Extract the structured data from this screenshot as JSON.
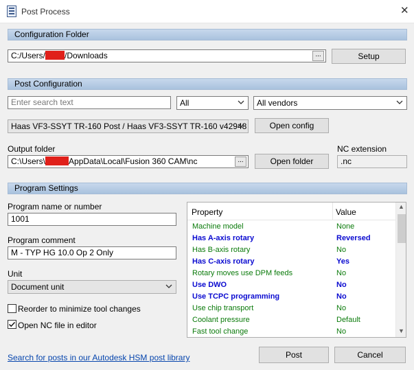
{
  "window": {
    "title": "Post Process",
    "close_glyph": "✕"
  },
  "config_folder": {
    "section_title": "Configuration Folder",
    "path_prefix": "C:/Users/",
    "path_suffix": "/Downloads",
    "browse_label": "...",
    "setup_label": "Setup"
  },
  "post_config": {
    "section_title": "Post Configuration",
    "search_placeholder": "Enter search text",
    "filter_all": "All",
    "vendor_filter": "All vendors",
    "post_selected": "Haas VF3-SSYT TR-160 Post / Haas VF3-SSYT TR-160 v42948",
    "open_config_label": "Open config",
    "output_folder_label": "Output folder",
    "output_prefix": "C:\\Users\\",
    "output_suffix": "AppData\\Local\\Fusion 360 CAM\\nc",
    "browse_label": "...",
    "open_folder_label": "Open folder",
    "nc_extension_label": "NC extension",
    "nc_extension_value": ".nc"
  },
  "program_settings": {
    "section_title": "Program Settings",
    "program_name_label": "Program name or number",
    "program_name_value": "1001",
    "program_comment_label": "Program comment",
    "program_comment_value": "M - TYP HG 10.0 Op 2 Only",
    "unit_label": "Unit",
    "unit_value": "Document unit",
    "reorder_label": "Reorder to minimize tool changes",
    "reorder_checked": false,
    "open_nc_label": "Open NC file in editor",
    "open_nc_checked": true
  },
  "properties": {
    "header_property": "Property",
    "header_value": "Value",
    "rows": [
      {
        "property": "Machine model",
        "value": "None",
        "style": "green"
      },
      {
        "property": "Has A-axis rotary",
        "value": "Reversed",
        "style": "blue"
      },
      {
        "property": "Has B-axis rotary",
        "value": "No",
        "style": "green"
      },
      {
        "property": "Has C-axis rotary",
        "value": "Yes",
        "style": "blue"
      },
      {
        "property": "Rotary moves use DPM feeds",
        "value": "No",
        "style": "green"
      },
      {
        "property": "Use DWO",
        "value": "No",
        "style": "blue"
      },
      {
        "property": "Use TCPC programming",
        "value": "No",
        "style": "blue"
      },
      {
        "property": "Use chip transport",
        "value": "No",
        "style": "green"
      },
      {
        "property": "Coolant pressure",
        "value": "Default",
        "style": "green"
      },
      {
        "property": "Fast tool change",
        "value": "No",
        "style": "green"
      }
    ]
  },
  "footer": {
    "search_link": "Search for posts in our Autodesk HSM post library",
    "post_label": "Post",
    "cancel_label": "Cancel"
  },
  "colors": {
    "section_header": "#b6cbe4",
    "property_green": "#0a7a0a",
    "property_blue": "#0a0ad0",
    "redaction": "#e0201a",
    "link": "#0645ad"
  }
}
